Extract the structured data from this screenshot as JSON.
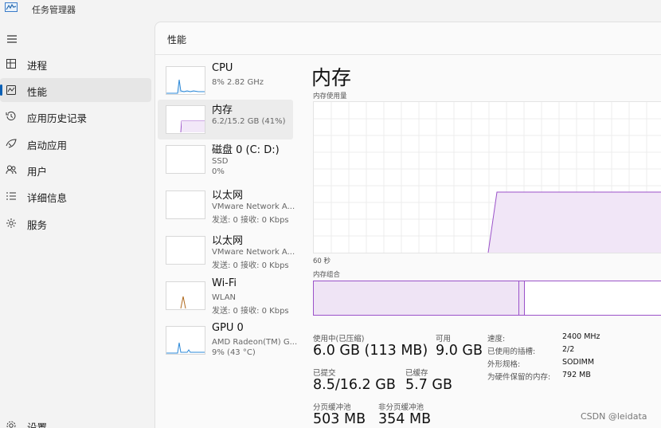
{
  "app": {
    "title": "任务管理器"
  },
  "nav": {
    "items": [
      {
        "id": "processes",
        "label": "进程",
        "icon": "processes-icon"
      },
      {
        "id": "performance",
        "label": "性能",
        "icon": "performance-icon",
        "active": true
      },
      {
        "id": "app-history",
        "label": "应用历史记录",
        "icon": "history-icon"
      },
      {
        "id": "startup",
        "label": "启动应用",
        "icon": "startup-icon"
      },
      {
        "id": "users",
        "label": "用户",
        "icon": "users-icon"
      },
      {
        "id": "details",
        "label": "详细信息",
        "icon": "details-icon"
      },
      {
        "id": "services",
        "label": "服务",
        "icon": "services-icon"
      }
    ],
    "settings_label": "设置"
  },
  "main": {
    "title": "性能"
  },
  "devices": [
    {
      "name": "CPU",
      "line1": "8% 2.82 GHz",
      "line2": "",
      "color": "#2b88d8"
    },
    {
      "name": "内存",
      "line1": "6.2/15.2 GB (41%)",
      "line2": "",
      "color": "#9b52c9",
      "active": true
    },
    {
      "name": "磁盘 0 (C: D:)",
      "line1": "SSD",
      "line2": "0%",
      "color": "#4caf50"
    },
    {
      "name": "以太网",
      "line1": "VMware Network A...",
      "line2": "发送: 0 接收: 0 Kbps",
      "color": "#b06a1f"
    },
    {
      "name": "以太网",
      "line1": "VMware Network A...",
      "line2": "发送: 0 接收: 0 Kbps",
      "color": "#b06a1f"
    },
    {
      "name": "Wi-Fi",
      "line1": "WLAN",
      "line2": "发送: 0 接收: 0 Kbps",
      "color": "#b06a1f"
    },
    {
      "name": "GPU 0",
      "line1": "AMD Radeon(TM) G...",
      "line2": "9% (43 °C)",
      "color": "#2b88d8"
    }
  ],
  "detail": {
    "title": "内存",
    "usage_label": "内存使用量",
    "time_label": "60 秒",
    "composition_label": "内存组合",
    "accent": "#9b52c9"
  },
  "stats": {
    "in_use_label": "使用中(已压缩)",
    "in_use_value": "6.0 GB (113 MB)",
    "available_label": "可用",
    "available_value": "9.0 GB",
    "committed_label": "已提交",
    "committed_value": "8.5/16.2 GB",
    "cached_label": "已缓存",
    "cached_value": "5.7 GB",
    "paged_label": "分页缓冲池",
    "paged_value": "503 MB",
    "nonpaged_label": "非分页缓冲池",
    "nonpaged_value": "354 MB"
  },
  "properties": {
    "speed_label": "速度:",
    "speed_value": "2400 MHz",
    "slots_label": "已使用的插槽:",
    "slots_value": "2/2",
    "form_label": "外形规格:",
    "form_value": "SODIMM",
    "reserved_label": "为硬件保留的内存:",
    "reserved_value": "792 MB"
  },
  "watermark": "CSDN @leidata"
}
